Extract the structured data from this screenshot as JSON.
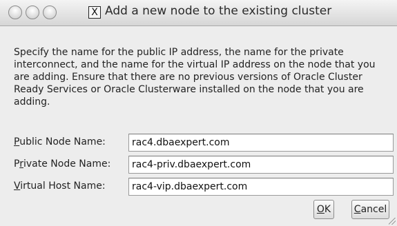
{
  "window": {
    "title": "Add a new node to the existing cluster",
    "app_icon": "java-x-icon",
    "app_icon_glyph": "X"
  },
  "description": "Specify the name for the public IP address, the name for the private interconnect, and the name for the virtual IP address on the node that you are adding.  Ensure that there are no previous versions of Oracle Cluster Ready Services or Oracle Clusterware installed on the node that you are adding.",
  "fields": [
    {
      "label_mnemonic": "P",
      "label_rest": "ublic Node Name:",
      "value": "rac4.dbaexpert.com"
    },
    {
      "label_pre": "P",
      "label_mnemonic": "r",
      "label_rest": "ivate Node Name:",
      "value": "rac4-priv.dbaexpert.com"
    },
    {
      "label_mnemonic": "V",
      "label_rest": "irtual Host Name:",
      "value": "rac4-vip.dbaexpert.com"
    }
  ],
  "buttons": {
    "ok_mnemonic": "O",
    "ok_rest": "K",
    "cancel_mnemonic": "C",
    "cancel_rest": "ancel"
  }
}
